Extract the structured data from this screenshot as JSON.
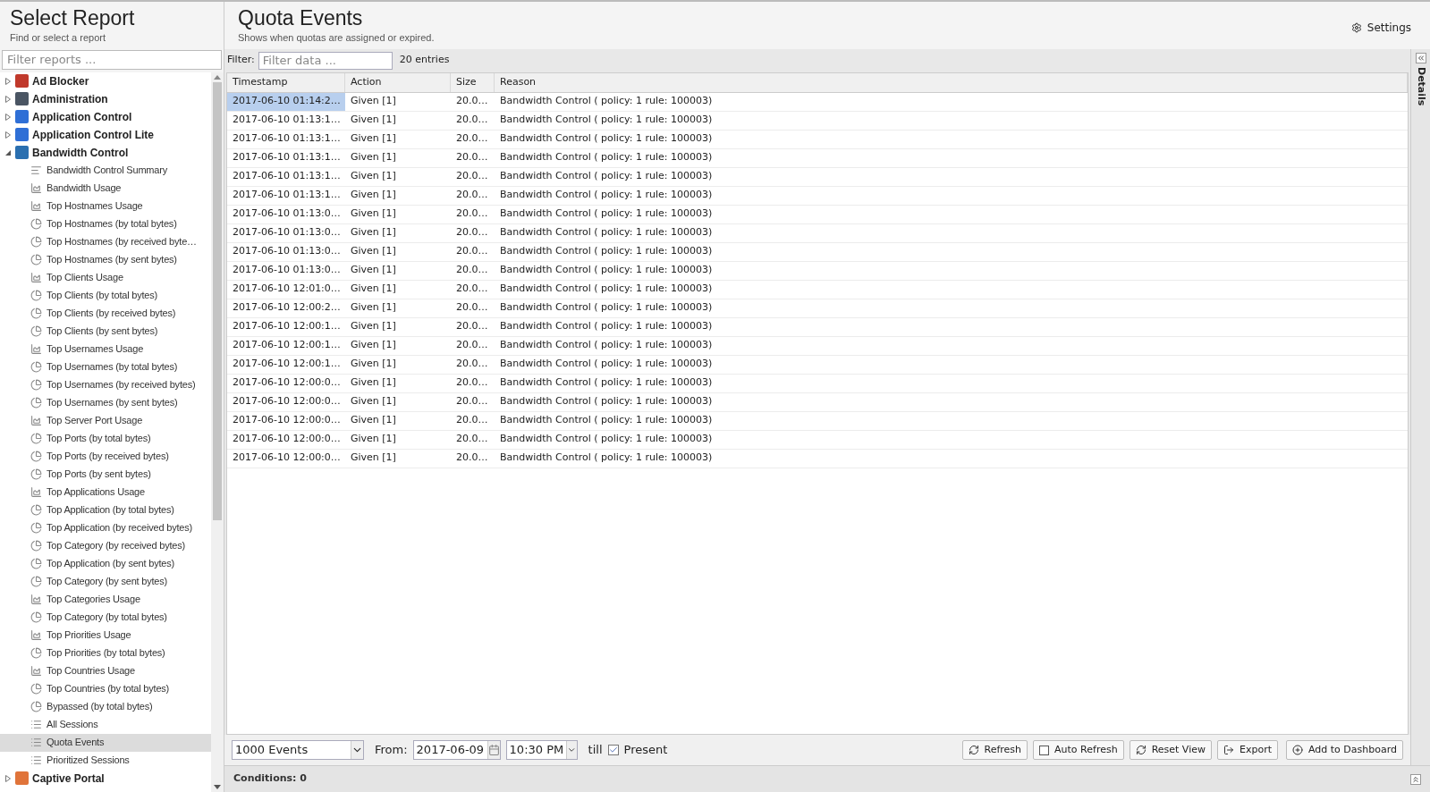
{
  "sidebar": {
    "title": "Select Report",
    "subtitle": "Find or select a report",
    "filter": {
      "placeholder": "Filter reports ..."
    },
    "tree": [
      {
        "label": "Ad Blocker",
        "color": "#c0392b",
        "expanded": false
      },
      {
        "label": "Administration",
        "color": "#4a5563",
        "expanded": false
      },
      {
        "label": "Application Control",
        "color": "#2f6fd6",
        "expanded": false
      },
      {
        "label": "Application Control Lite",
        "color": "#2f6fd6",
        "expanded": false
      },
      {
        "label": "Bandwidth Control",
        "color": "#2a6fb0",
        "expanded": true,
        "children": [
          {
            "label": "Bandwidth Control Summary",
            "kind": "summary",
            "selected": false
          },
          {
            "label": "Bandwidth Usage",
            "kind": "area",
            "selected": false
          },
          {
            "label": "Top Hostnames Usage",
            "kind": "area",
            "selected": false
          },
          {
            "label": "Top Hostnames (by total bytes)",
            "kind": "pie",
            "selected": false
          },
          {
            "label": "Top Hostnames (by received byte…",
            "kind": "pie",
            "selected": false
          },
          {
            "label": "Top Hostnames (by sent bytes)",
            "kind": "pie",
            "selected": false
          },
          {
            "label": "Top Clients Usage",
            "kind": "area",
            "selected": false
          },
          {
            "label": "Top Clients (by total bytes)",
            "kind": "pie",
            "selected": false
          },
          {
            "label": "Top Clients (by received bytes)",
            "kind": "pie",
            "selected": false
          },
          {
            "label": "Top Clients (by sent bytes)",
            "kind": "pie",
            "selected": false
          },
          {
            "label": "Top Usernames Usage",
            "kind": "area",
            "selected": false
          },
          {
            "label": "Top Usernames (by total bytes)",
            "kind": "pie",
            "selected": false
          },
          {
            "label": "Top Usernames (by received bytes)",
            "kind": "pie",
            "selected": false
          },
          {
            "label": "Top Usernames (by sent bytes)",
            "kind": "pie",
            "selected": false
          },
          {
            "label": "Top Server Port Usage",
            "kind": "area",
            "selected": false
          },
          {
            "label": "Top Ports (by total bytes)",
            "kind": "pie",
            "selected": false
          },
          {
            "label": "Top Ports (by received bytes)",
            "kind": "pie",
            "selected": false
          },
          {
            "label": "Top Ports (by sent bytes)",
            "kind": "pie",
            "selected": false
          },
          {
            "label": "Top Applications Usage",
            "kind": "area",
            "selected": false
          },
          {
            "label": "Top Application (by total bytes)",
            "kind": "pie",
            "selected": false
          },
          {
            "label": "Top Application (by received bytes)",
            "kind": "pie",
            "selected": false
          },
          {
            "label": "Top Category (by received bytes)",
            "kind": "pie",
            "selected": false
          },
          {
            "label": "Top Application (by sent bytes)",
            "kind": "pie",
            "selected": false
          },
          {
            "label": "Top Category (by sent bytes)",
            "kind": "pie",
            "selected": false
          },
          {
            "label": "Top Categories Usage",
            "kind": "area",
            "selected": false
          },
          {
            "label": "Top Category (by total bytes)",
            "kind": "pie",
            "selected": false
          },
          {
            "label": "Top Priorities Usage",
            "kind": "area",
            "selected": false
          },
          {
            "label": "Top Priorities (by total bytes)",
            "kind": "pie",
            "selected": false
          },
          {
            "label": "Top Countries Usage",
            "kind": "area",
            "selected": false
          },
          {
            "label": "Top Countries (by total bytes)",
            "kind": "pie",
            "selected": false
          },
          {
            "label": "Bypassed (by total bytes)",
            "kind": "pie",
            "selected": false
          },
          {
            "label": "All Sessions",
            "kind": "list",
            "selected": false
          },
          {
            "label": "Quota Events",
            "kind": "list",
            "selected": true
          },
          {
            "label": "Prioritized Sessions",
            "kind": "list",
            "selected": false
          }
        ]
      },
      {
        "label": "Captive Portal",
        "color": "#e0743a",
        "expanded": false
      }
    ]
  },
  "header": {
    "title": "Quota Events",
    "subtitle": "Shows when quotas are assigned or expired.",
    "settings": "Settings"
  },
  "filter_bar": {
    "label": "Filter:",
    "placeholder": "Filter data ...",
    "count": "20 entries"
  },
  "table": {
    "columns": [
      "Timestamp",
      "Action",
      "Size",
      "Reason"
    ],
    "rows": [
      {
        "selected": true,
        "cells": [
          "2017-06-10 01:14:2…",
          "Given [1]",
          "20.0…",
          "Bandwidth Control ( policy: 1 rule: 100003)"
        ]
      },
      {
        "selected": false,
        "cells": [
          "2017-06-10 01:13:1…",
          "Given [1]",
          "20.0…",
          "Bandwidth Control ( policy: 1 rule: 100003)"
        ]
      },
      {
        "selected": false,
        "cells": [
          "2017-06-10 01:13:1…",
          "Given [1]",
          "20.0…",
          "Bandwidth Control ( policy: 1 rule: 100003)"
        ]
      },
      {
        "selected": false,
        "cells": [
          "2017-06-10 01:13:1…",
          "Given [1]",
          "20.0…",
          "Bandwidth Control ( policy: 1 rule: 100003)"
        ]
      },
      {
        "selected": false,
        "cells": [
          "2017-06-10 01:13:1…",
          "Given [1]",
          "20.0…",
          "Bandwidth Control ( policy: 1 rule: 100003)"
        ]
      },
      {
        "selected": false,
        "cells": [
          "2017-06-10 01:13:1…",
          "Given [1]",
          "20.0…",
          "Bandwidth Control ( policy: 1 rule: 100003)"
        ]
      },
      {
        "selected": false,
        "cells": [
          "2017-06-10 01:13:0…",
          "Given [1]",
          "20.0…",
          "Bandwidth Control ( policy: 1 rule: 100003)"
        ]
      },
      {
        "selected": false,
        "cells": [
          "2017-06-10 01:13:0…",
          "Given [1]",
          "20.0…",
          "Bandwidth Control ( policy: 1 rule: 100003)"
        ]
      },
      {
        "selected": false,
        "cells": [
          "2017-06-10 01:13:0…",
          "Given [1]",
          "20.0…",
          "Bandwidth Control ( policy: 1 rule: 100003)"
        ]
      },
      {
        "selected": false,
        "cells": [
          "2017-06-10 01:13:0…",
          "Given [1]",
          "20.0…",
          "Bandwidth Control ( policy: 1 rule: 100003)"
        ]
      },
      {
        "selected": false,
        "cells": [
          "2017-06-10 12:01:0…",
          "Given [1]",
          "20.0…",
          "Bandwidth Control ( policy: 1 rule: 100003)"
        ]
      },
      {
        "selected": false,
        "cells": [
          "2017-06-10 12:00:2…",
          "Given [1]",
          "20.0…",
          "Bandwidth Control ( policy: 1 rule: 100003)"
        ]
      },
      {
        "selected": false,
        "cells": [
          "2017-06-10 12:00:1…",
          "Given [1]",
          "20.0…",
          "Bandwidth Control ( policy: 1 rule: 100003)"
        ]
      },
      {
        "selected": false,
        "cells": [
          "2017-06-10 12:00:1…",
          "Given [1]",
          "20.0…",
          "Bandwidth Control ( policy: 1 rule: 100003)"
        ]
      },
      {
        "selected": false,
        "cells": [
          "2017-06-10 12:00:1…",
          "Given [1]",
          "20.0…",
          "Bandwidth Control ( policy: 1 rule: 100003)"
        ]
      },
      {
        "selected": false,
        "cells": [
          "2017-06-10 12:00:0…",
          "Given [1]",
          "20.0…",
          "Bandwidth Control ( policy: 1 rule: 100003)"
        ]
      },
      {
        "selected": false,
        "cells": [
          "2017-06-10 12:00:0…",
          "Given [1]",
          "20.0…",
          "Bandwidth Control ( policy: 1 rule: 100003)"
        ]
      },
      {
        "selected": false,
        "cells": [
          "2017-06-10 12:00:0…",
          "Given [1]",
          "20.0…",
          "Bandwidth Control ( policy: 1 rule: 100003)"
        ]
      },
      {
        "selected": false,
        "cells": [
          "2017-06-10 12:00:0…",
          "Given [1]",
          "20.0…",
          "Bandwidth Control ( policy: 1 rule: 100003)"
        ]
      },
      {
        "selected": false,
        "cells": [
          "2017-06-10 12:00:0…",
          "Given [1]",
          "20.0…",
          "Bandwidth Control ( policy: 1 rule: 100003)"
        ]
      }
    ]
  },
  "details_panel": {
    "label": "Details"
  },
  "toolbar": {
    "limit": "1000 Events",
    "from_label": "From:",
    "date": "2017-06-09",
    "time": "10:30 PM",
    "till_label": "till",
    "present": {
      "label": "Present",
      "checked": true
    },
    "buttons": [
      {
        "label": "Refresh",
        "kind": "refresh"
      },
      {
        "label": "Auto Refresh",
        "kind": "checkbox",
        "checked": false
      },
      {
        "label": "Reset View",
        "kind": "refresh"
      },
      {
        "label": "Export",
        "kind": "export"
      },
      {
        "label": "Add to Dashboard",
        "kind": "add"
      }
    ]
  },
  "conditions": {
    "label": "Conditions: 0"
  }
}
